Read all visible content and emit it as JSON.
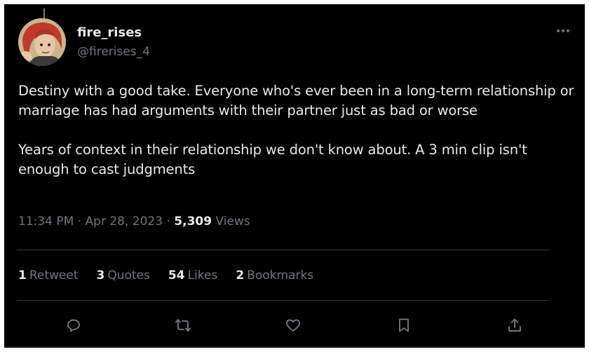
{
  "tweet": {
    "display_name": "fire_rises",
    "handle": "@firerises_4",
    "text": "Destiny with a good take. Everyone who's ever been in a long-term relationship or marriage has had arguments with their partner just as bad or worse\n\nYears of context in their relationship we don't know about. A 3 min clip isn't enough to cast judgments",
    "time": "11:34 PM",
    "date": "Apr 28, 2023",
    "views_count": "5,309",
    "views_label": "Views",
    "separator": "·"
  },
  "stats": {
    "retweets": {
      "count": "1",
      "label": "Retweet"
    },
    "quotes": {
      "count": "3",
      "label": "Quotes"
    },
    "likes": {
      "count": "54",
      "label": "Likes"
    },
    "bookmarks": {
      "count": "2",
      "label": "Bookmarks"
    }
  },
  "icons": {
    "reply": "reply-icon",
    "retweet": "retweet-icon",
    "like": "heart-icon",
    "bookmark": "bookmark-icon",
    "share": "share-icon",
    "more": "more-icon"
  },
  "colors": {
    "background": "#000000",
    "text": "#e7e9ea",
    "muted": "#71767b",
    "divider": "#2f3336"
  }
}
